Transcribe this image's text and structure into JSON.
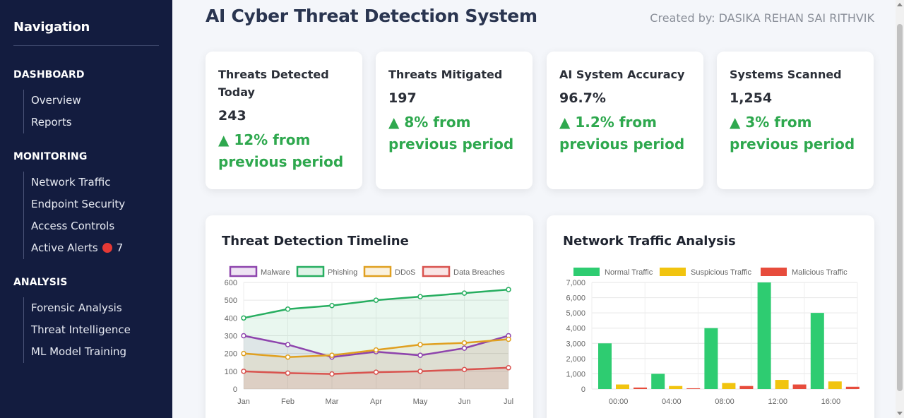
{
  "sidebar": {
    "title": "Navigation",
    "sections": [
      {
        "heading": "DASHBOARD",
        "items": [
          "Overview",
          "Reports"
        ]
      },
      {
        "heading": "MONITORING",
        "items": [
          "Network Traffic",
          "Endpoint Security",
          "Access Controls",
          "Active Alerts"
        ]
      },
      {
        "heading": "ANALYSIS",
        "items": [
          "Forensic Analysis",
          "Threat Intelligence",
          "ML Model Training"
        ]
      }
    ],
    "alert_count": "7"
  },
  "header": {
    "title": "AI Cyber Threat Detection System",
    "creator": "Created by: DASIKA REHAN SAI RITHVIK"
  },
  "stats": [
    {
      "label": "Threats Detected Today",
      "value": "243",
      "change": "▲ 12% from previous period"
    },
    {
      "label": "Threats Mitigated",
      "value": "197",
      "change": "▲ 8% from previous period"
    },
    {
      "label": "AI System Accuracy",
      "value": "96.7%",
      "change": "▲ 1.2% from previous period"
    },
    {
      "label": "Systems Scanned",
      "value": "1,254",
      "change": "▲ 3% from previous period"
    }
  ],
  "charts": {
    "timeline_title": "Threat Detection Timeline",
    "traffic_title": "Network Traffic Analysis"
  },
  "chart_data": [
    {
      "type": "line",
      "title": "Threat Detection Timeline",
      "x": [
        "Jan",
        "Feb",
        "Mar",
        "Apr",
        "May",
        "Jun",
        "Jul"
      ],
      "ylim": [
        0,
        600
      ],
      "yticks": [
        0,
        100,
        200,
        300,
        400,
        500,
        600
      ],
      "grid": true,
      "legend": "top",
      "area": true,
      "series": [
        {
          "name": "Malware",
          "color": "#8e44ad",
          "values": [
            300,
            250,
            180,
            210,
            190,
            230,
            300
          ]
        },
        {
          "name": "Phishing",
          "color": "#27ae60",
          "values": [
            400,
            450,
            470,
            500,
            520,
            540,
            560
          ]
        },
        {
          "name": "DDoS",
          "color": "#e0a020",
          "values": [
            200,
            180,
            190,
            220,
            250,
            260,
            280
          ]
        },
        {
          "name": "Data Breaches",
          "color": "#d9534f",
          "values": [
            100,
            90,
            85,
            95,
            100,
            110,
            120
          ]
        }
      ]
    },
    {
      "type": "bar",
      "title": "Network Traffic Analysis",
      "categories": [
        "00:00",
        "04:00",
        "08:00",
        "12:00",
        "16:00"
      ],
      "ylim": [
        0,
        7000
      ],
      "yticks": [
        "0",
        "1,000",
        "2,000",
        "3,000",
        "4,000",
        "5,000",
        "6,000",
        "7,000"
      ],
      "grid": true,
      "legend": "top",
      "series": [
        {
          "name": "Normal Traffic",
          "color": "#2ecc71",
          "values": [
            3000,
            1000,
            4000,
            7000,
            5000
          ]
        },
        {
          "name": "Suspicious Traffic",
          "color": "#f1c40f",
          "values": [
            300,
            200,
            400,
            600,
            500
          ]
        },
        {
          "name": "Malicious Traffic",
          "color": "#e74c3c",
          "values": [
            100,
            50,
            200,
            300,
            150
          ]
        }
      ]
    }
  ]
}
